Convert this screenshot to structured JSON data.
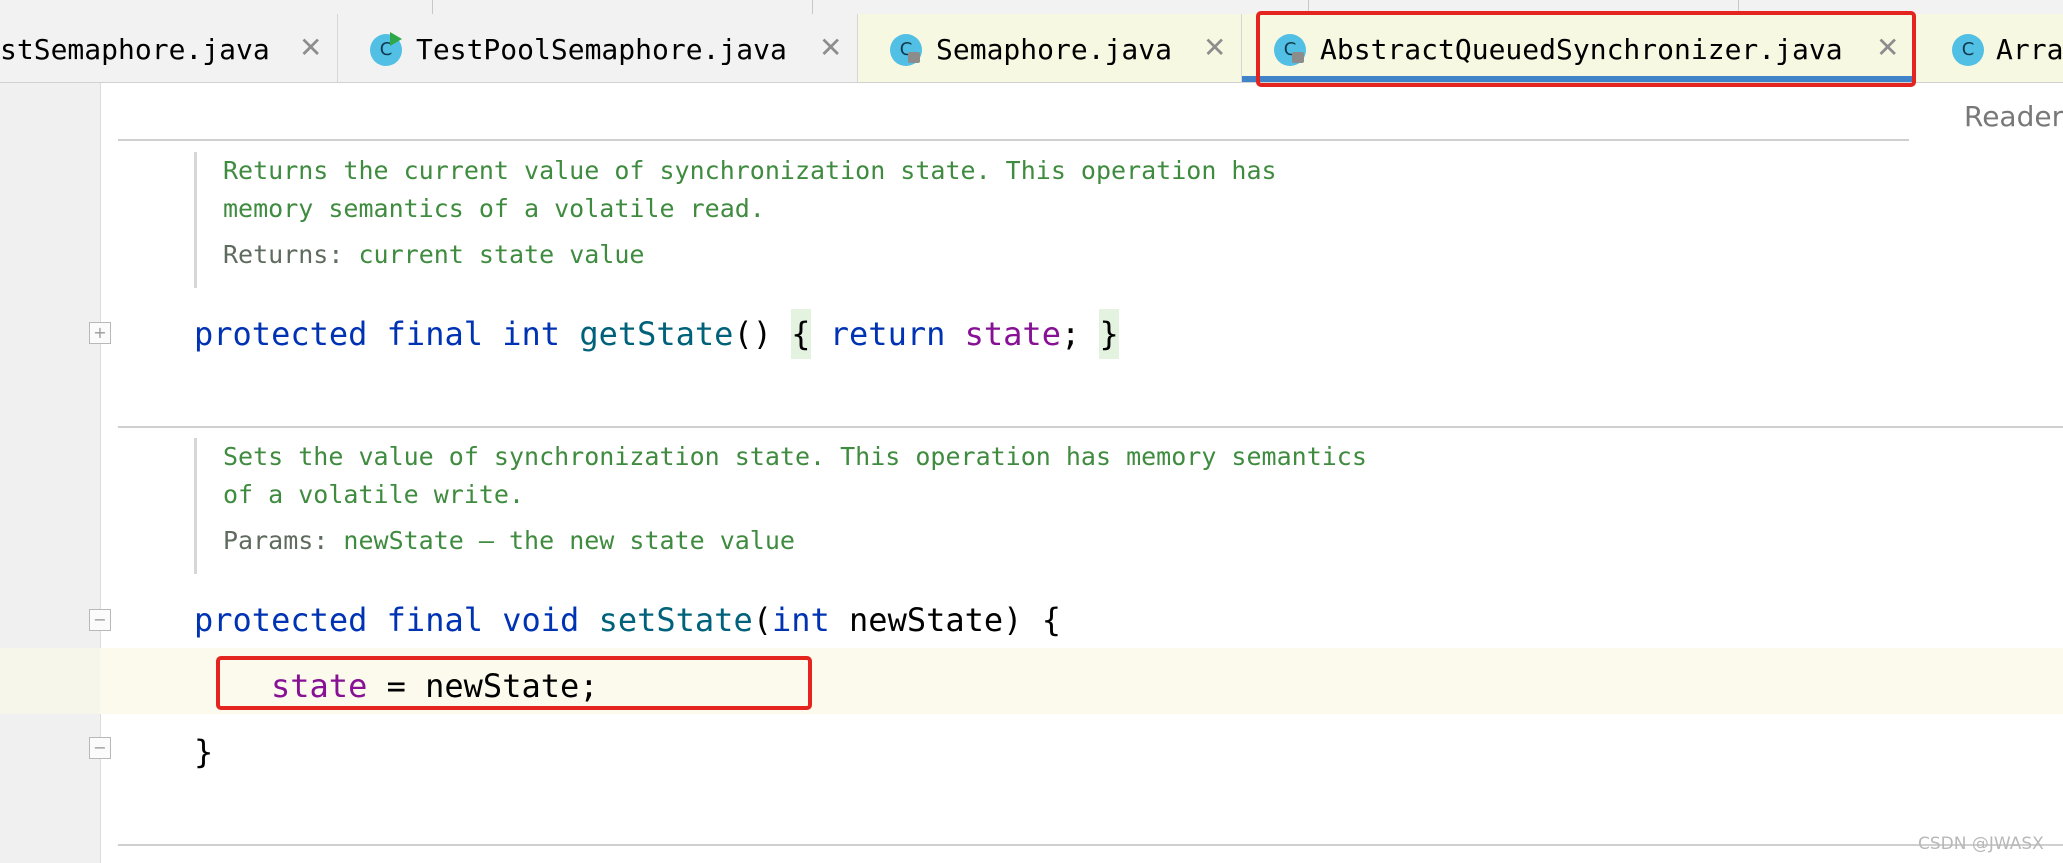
{
  "tabs": [
    {
      "label": "stSemaphore.java",
      "icon": "class-icon",
      "icon_letter": ""
    },
    {
      "label": "TestPoolSemaphore.java",
      "icon": "runnable-class-icon",
      "icon_letter": "C"
    },
    {
      "label": "Semaphore.java",
      "icon": "locked-class-icon",
      "icon_letter": "C"
    },
    {
      "label": "AbstractQueuedSynchronizer.java",
      "icon": "locked-class-icon",
      "icon_letter": "C",
      "active": true
    },
    {
      "label": "Arra",
      "icon": "class-icon",
      "icon_letter": "C"
    }
  ],
  "editor": {
    "reader_mode_label": "Reader",
    "doc1": {
      "line1": "Returns the current value of synchronization state. This operation has",
      "line2": "memory semantics of a volatile read.",
      "returns_tag": "Returns:",
      "returns_text": "current state value"
    },
    "getstate": {
      "modifier1": "protected",
      "modifier2": "final",
      "type": "int",
      "name": "getState",
      "parens": "()",
      "open_brace": "{",
      "return_kw": "return",
      "field": "state",
      "semicolon": ";",
      "close_brace": "}"
    },
    "doc2": {
      "line1": "Sets the value of synchronization state. This operation has memory semantics",
      "line2": "of a volatile write.",
      "params_tag": "Params:",
      "params_text": "newState – the new state value"
    },
    "setstate": {
      "modifier1": "protected",
      "modifier2": "final",
      "type": "void",
      "name": "setState",
      "paren_open": "(",
      "param_type": "int",
      "param_name": "newState",
      "paren_close_brace": ") {",
      "body_field": "state",
      "body_rest": " = newState;",
      "close_brace": "}"
    }
  },
  "watermark": "CSDN @JWASX",
  "colors": {
    "keyword": "#0033b3",
    "method": "#00627a",
    "field": "#871094",
    "doc_comment": "#3f8b3f",
    "highlight_box": "#e3241f",
    "active_tab_underline": "#4083c9"
  }
}
